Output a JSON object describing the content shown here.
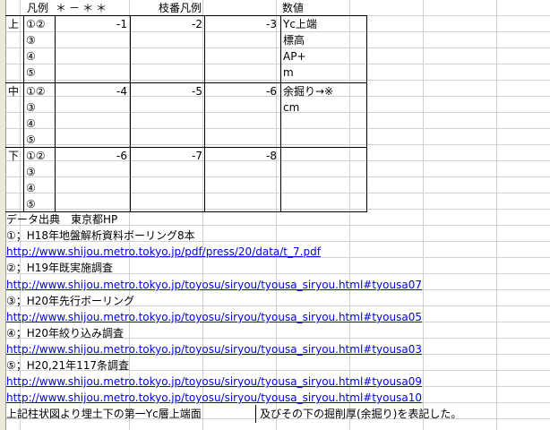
{
  "header": {
    "legend": "凡例",
    "code": "＊－＊＊",
    "branch_legend": "枝番凡例",
    "value": "数値"
  },
  "groups": [
    {
      "label": "上",
      "symbols": [
        "①②",
        "③",
        "④",
        "⑤"
      ],
      "branches": [
        "-1",
        "-2",
        "-3"
      ],
      "values": [
        "Yc上端",
        "標高",
        "AP+",
        "m"
      ]
    },
    {
      "label": "中",
      "symbols": [
        "①②",
        "③",
        "④",
        "⑤"
      ],
      "branches": [
        "-4",
        "-5",
        "-6"
      ],
      "values": [
        "余掘り→※",
        "cm",
        "",
        ""
      ]
    },
    {
      "label": "下",
      "symbols": [
        "①②",
        "③",
        "④",
        "⑤"
      ],
      "branches": [
        "-6",
        "-7",
        "-8"
      ],
      "values": [
        "",
        "",
        "",
        ""
      ]
    }
  ],
  "notes": {
    "source": "データ出典　東京都HP",
    "s1": "①；H18年地盤解析資料ボーリング8本",
    "s1_url": "http://www.shijou.metro.tokyo.jp/pdf/press/20/data/t_7.pdf",
    "s2": "②；H19年既実施調査",
    "s2_url": "http://www.shijou.metro.tokyo.jp/toyosu/siryou/tyousa_siryou.html#tyousa07",
    "s3": "③；H20年先行ボーリング",
    "s3_url": "http://www.shijou.metro.tokyo.jp/toyosu/siryou/tyousa_siryou.html#tyousa05",
    "s4": "④；H20年絞り込み調査",
    "s4_url": "http://www.shijou.metro.tokyo.jp/toyosu/siryou/tyousa_siryou.html#tyousa03",
    "s5": "⑤；H20,21年117条調査",
    "s5_url": "http://www.shijou.metro.tokyo.jp/toyosu/siryou/tyousa_siryou.html#tyousa09",
    "s5_url2": "http://www.shijou.metro.tokyo.jp/toyosu/siryou/tyousa_siryou.html#tyousa10",
    "footer_a": "上記柱状図より埋土下の第一Yc層上端面",
    "footer_b": "及びその下の掘削厚(余掘り)を表記した。"
  }
}
